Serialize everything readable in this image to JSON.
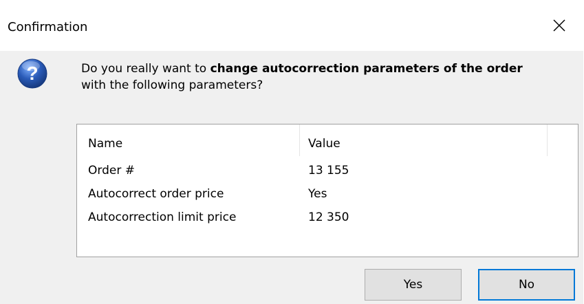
{
  "window": {
    "title": "Confirmation"
  },
  "icons": {
    "close": "close-icon",
    "question": "question-icon"
  },
  "message": {
    "part1": "Do you really want to ",
    "bold": "change autocorrection parameters of the order",
    "part2": "with the following parameters?"
  },
  "table": {
    "headers": [
      "Name",
      "Value"
    ],
    "rows": [
      {
        "name": "Order #",
        "value": "13 155"
      },
      {
        "name": "Autocorrect order price",
        "value": "Yes"
      },
      {
        "name": "Autocorrection limit price",
        "value": "12 350"
      }
    ]
  },
  "buttons": {
    "yes_label": "Yes",
    "no_label": "No"
  },
  "colors": {
    "accent": "#0078d7",
    "dialog_bg": "#f0f0f0",
    "icon_blue": "#2a5bb8"
  }
}
